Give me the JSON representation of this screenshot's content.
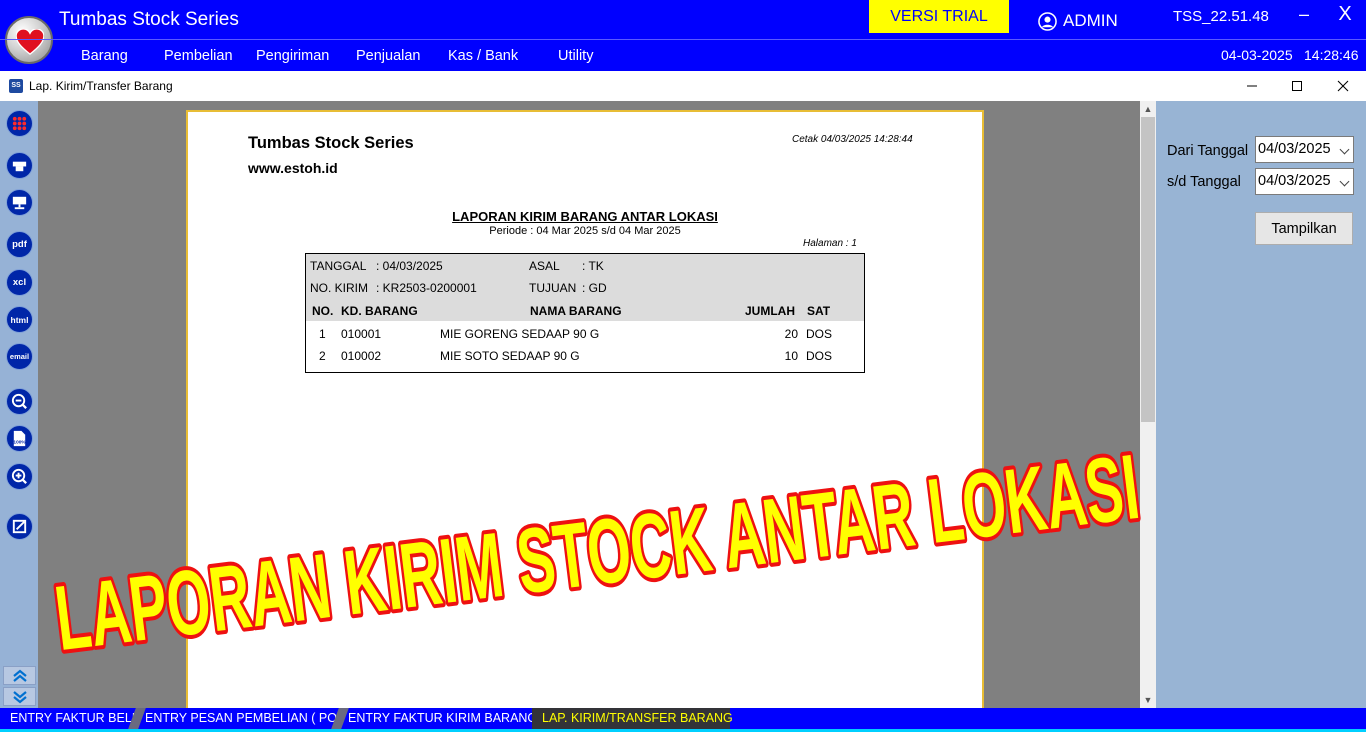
{
  "app": {
    "title": "Tumbas Stock Series",
    "trial_badge": "VERSI TRIAL",
    "user": "ADMIN",
    "version": "TSS_22.51.48",
    "minimize_glyph": "–",
    "close_glyph": "X",
    "date": "04-03-2025",
    "time": "14:28:46"
  },
  "menu": [
    "Barang",
    "Pembelian",
    "Pengiriman",
    "Penjualan",
    "Kas / Bank",
    "Utility"
  ],
  "child_window": {
    "icon_text": "SS",
    "title": "Lap. Kirim/Transfer Barang"
  },
  "toolbar": {
    "pdf_label": "pdf",
    "xcl_label": "xcl",
    "html_label": "html",
    "email_label": "email",
    "zoom100_label": "100%"
  },
  "report": {
    "company": "Tumbas Stock Series",
    "website": "www.estoh.id",
    "print_time": "Cetak 04/03/2025 14:28:44",
    "title": "LAPORAN KIRIM BARANG ANTAR LOKASI",
    "period": "Periode : 04 Mar 2025  s/d  04 Mar 2025",
    "page": "Halaman : 1",
    "header": {
      "tanggal_label": "TANGGAL",
      "tanggal_value": ": 04/03/2025",
      "asal_label": "ASAL",
      "asal_value": ": TK",
      "nokirim_label": "NO. KIRIM",
      "nokirim_value": ": KR2503-0200001",
      "tujuan_label": "TUJUAN",
      "tujuan_value": ": GD"
    },
    "columns": {
      "no": "NO.",
      "kd": "KD. BARANG",
      "nama": "NAMA BARANG",
      "jumlah": "JUMLAH",
      "sat": "SAT"
    },
    "rows": [
      {
        "no": "1",
        "kd": "010001",
        "nama": "MIE GORENG SEDAAP 90 G",
        "jumlah": "20",
        "sat": "DOS"
      },
      {
        "no": "2",
        "kd": "010002",
        "nama": "MIE SOTO SEDAAP 90 G",
        "jumlah": "10",
        "sat": "DOS"
      }
    ]
  },
  "filter": {
    "from_label": "Dari Tanggal",
    "from_value": "04/03/2025",
    "to_label": "s/d Tanggal",
    "to_value": "04/03/2025",
    "show_button": "Tampilkan"
  },
  "tasks": [
    "ENTRY FAKTUR BELI",
    "ENTRY PESAN PEMBELIAN ( PO )",
    "ENTRY FAKTUR KIRIM BARANG",
    "LAP. KIRIM/TRANSFER BARANG"
  ],
  "banner_text": "LAPORAN KIRIM STOCK ANTAR LOKASI",
  "colors": {
    "app_blue": "#0000ff",
    "trial_yellow": "#ffff00",
    "banner_yellow": "#ffff00",
    "banner_red": "#ee1111",
    "panel_blue": "#98b4d4",
    "tool_blue": "#0026a8"
  }
}
